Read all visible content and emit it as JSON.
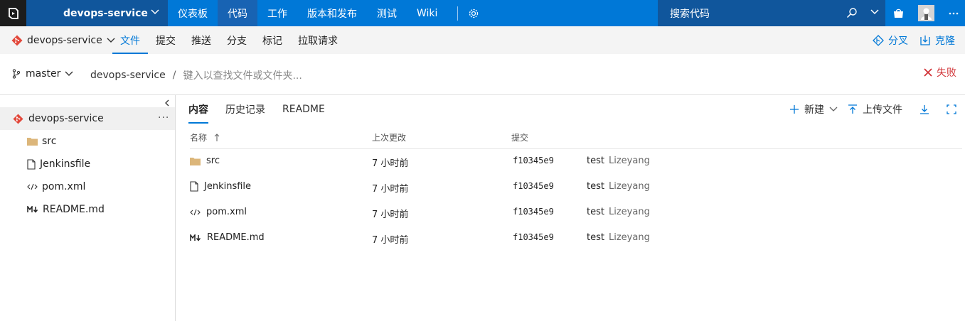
{
  "topnav": {
    "project": "devops-service",
    "items": [
      {
        "label": "仪表板",
        "active": false
      },
      {
        "label": "代码",
        "active": true
      },
      {
        "label": "工作",
        "active": false
      },
      {
        "label": "版本和发布",
        "active": false
      },
      {
        "label": "测试",
        "active": false
      },
      {
        "label": "Wiki",
        "active": false
      }
    ],
    "search_placeholder": "搜索代码",
    "icons": [
      "vsts-logo-icon",
      "settings-gear-icon",
      "search-icon",
      "chevron-down-icon",
      "marketplace-bag-icon",
      "user-avatar",
      "more-icon"
    ]
  },
  "subnav": {
    "repo": "devops-service",
    "tabs": [
      {
        "label": "文件",
        "active": true
      },
      {
        "label": "提交",
        "active": false
      },
      {
        "label": "推送",
        "active": false
      },
      {
        "label": "分支",
        "active": false
      },
      {
        "label": "标记",
        "active": false
      },
      {
        "label": "拉取请求",
        "active": false
      }
    ],
    "fork_label": "分叉",
    "clone_label": "克隆"
  },
  "pathbar": {
    "branch": "master",
    "repo": "devops-service",
    "separator": "/",
    "placeholder": "键入以查找文件或文件夹...",
    "status": "失败"
  },
  "tree": {
    "root": "devops-service",
    "more": "···",
    "items": [
      {
        "name": "src",
        "icon": "folder-icon"
      },
      {
        "name": "Jenkinsfile",
        "icon": "file-icon"
      },
      {
        "name": "pom.xml",
        "icon": "code-file-icon"
      },
      {
        "name": "README.md",
        "icon": "markdown-icon"
      }
    ]
  },
  "content": {
    "tabs": [
      {
        "label": "内容",
        "active": true
      },
      {
        "label": "历史记录",
        "active": false
      },
      {
        "label": "README",
        "active": false
      }
    ],
    "new_label": "新建",
    "upload_label": "上传文件",
    "columns": {
      "name": "名称",
      "last_change": "上次更改",
      "commit": "提交"
    },
    "rows": [
      {
        "name": "src",
        "icon": "folder-icon",
        "last_change": "7 小时前",
        "commit": "f10345e9",
        "message": "test",
        "author": "Lizeyang"
      },
      {
        "name": "Jenkinsfile",
        "icon": "file-icon",
        "last_change": "7 小时前",
        "commit": "f10345e9",
        "message": "test",
        "author": "Lizeyang"
      },
      {
        "name": "pom.xml",
        "icon": "code-file-icon",
        "last_change": "7 小时前",
        "commit": "f10345e9",
        "message": "test",
        "author": "Lizeyang"
      },
      {
        "name": "README.md",
        "icon": "markdown-icon",
        "last_change": "7 小时前",
        "commit": "f10345e9",
        "message": "test",
        "author": "Lizeyang"
      }
    ]
  },
  "colors": {
    "accent": "#0078d7",
    "project_bg": "#10569c",
    "error": "#d13438",
    "folder": "#dcb67a",
    "git": "#e2483b"
  }
}
